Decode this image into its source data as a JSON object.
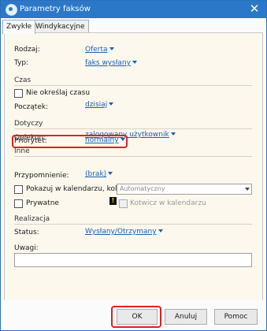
{
  "window": {
    "title": "Parametry faksów",
    "close_glyph": "✕"
  },
  "tabs": [
    {
      "label": "Zwykłe",
      "active": true
    },
    {
      "label": "Windykacyjne",
      "active": false
    }
  ],
  "fields": {
    "rodzaj": {
      "label": "Rodzaj:",
      "value": "Oferta"
    },
    "typ": {
      "label": "Typ:",
      "value": "faks wysłany"
    }
  },
  "czas": {
    "section": "Czas",
    "nie_okreslaj": {
      "label": "Nie określaj czasu",
      "checked": false
    },
    "poczatek": {
      "label": "Początek:",
      "value": "dzisiaj"
    }
  },
  "dotyczy": {
    "section": "Dotyczy",
    "opiekun": {
      "label": "Opiekun:",
      "value": "zalogowany użytkownik"
    }
  },
  "inne": {
    "section": "Inne",
    "priorytet": {
      "label": "Priorytet:",
      "value": "normalny"
    },
    "przypomnienie": {
      "label": "Przypomnienie:",
      "value": "(brak)"
    },
    "pokazuj": {
      "label": "Pokazuj w kalendarzu, kolor:",
      "checked": false,
      "color_value": "Automatyczny"
    },
    "prywatne": {
      "label": "Prywatne",
      "checked": false
    },
    "kotwicz": {
      "label": "Kotwicz w kalendarzu",
      "checked": false
    }
  },
  "realizacja": {
    "section": "Realizacja",
    "status": {
      "label": "Status:",
      "value": "Wysłany/Otrzymany"
    },
    "uwagi": {
      "label": "Uwagi:",
      "value": ""
    }
  },
  "buttons": {
    "ok": "OK",
    "anuluj": "Anuluj",
    "pomoc": "Pomoc"
  },
  "colors": {
    "titlebar": "#2c78c8",
    "link": "#1a5fb4",
    "highlight": "#e02020",
    "panel_bg": "#fcf8ee"
  }
}
